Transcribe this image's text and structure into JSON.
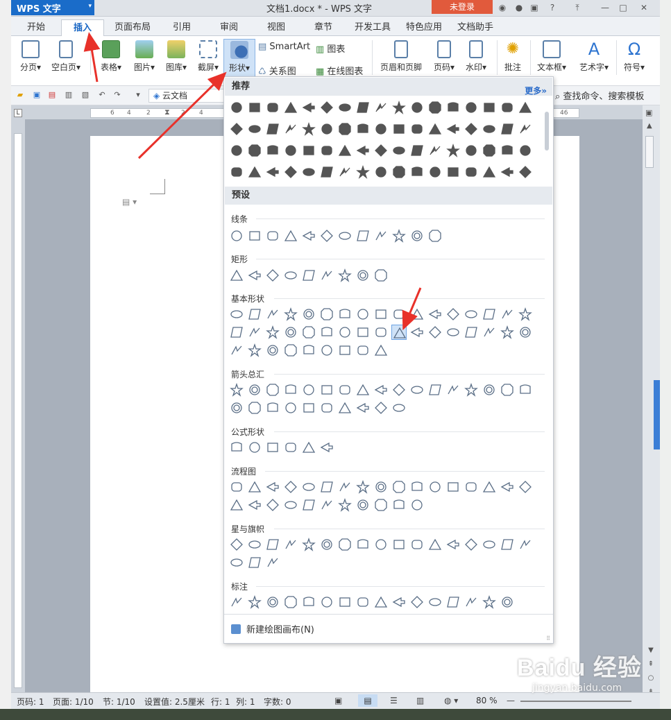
{
  "app": {
    "logo": "WPS 文字",
    "title": "文档1.docx * - WPS 文字",
    "login": "未登录"
  },
  "tabs": [
    "开始",
    "插入",
    "页面布局",
    "引用",
    "审阅",
    "视图",
    "章节",
    "开发工具",
    "特色应用",
    "文档助手"
  ],
  "active_tab": "插入",
  "ribbon": {
    "fenye": "分页",
    "kongbaiye": "空白页",
    "biaoge": "表格",
    "tupian": "图片",
    "tuku": "图库",
    "jieping": "截屏",
    "xingzhuang": "形状",
    "smartart": "SmartArt",
    "tubiao": "图表",
    "guanxitu": "关系图",
    "zaixiantubiao": "在线图表",
    "yemei": "页眉和页脚",
    "yema": "页码",
    "shuiyin": "水印",
    "pizhu": "批注",
    "wenbenkuang": "文本框",
    "yishuzi": "艺术字",
    "fuhao": "符号"
  },
  "quickbar": {
    "yun": "云文档",
    "find": "查找命令、搜索模板"
  },
  "ruler_numbers": [
    "6",
    "4",
    "2",
    "2",
    "4",
    "46"
  ],
  "panel": {
    "recommend": "推荐",
    "more": "更多»",
    "preset": "预设",
    "categories": [
      "线条",
      "矩形",
      "基本形状",
      "箭头总汇",
      "公式形状",
      "流程图",
      "星与旗帜",
      "标注"
    ],
    "new_canvas": "新建绘图画布(N)"
  },
  "status": {
    "page": "页码: 1",
    "pages": "页面: 1/10",
    "section": "节: 1/10",
    "setting": "设置值: 2.5厘米",
    "row": "行: 1",
    "col": "列: 1",
    "words": "字数: 0",
    "zoom": "80 %"
  },
  "watermark": {
    "brand": "Baidu 经验",
    "url": "jingyan.baidu.com"
  },
  "colors": {
    "accent": "#1a67c4",
    "selection": "#cfe2f7",
    "arrow": "#e8312a",
    "shape_stroke": "#5a6e86"
  }
}
